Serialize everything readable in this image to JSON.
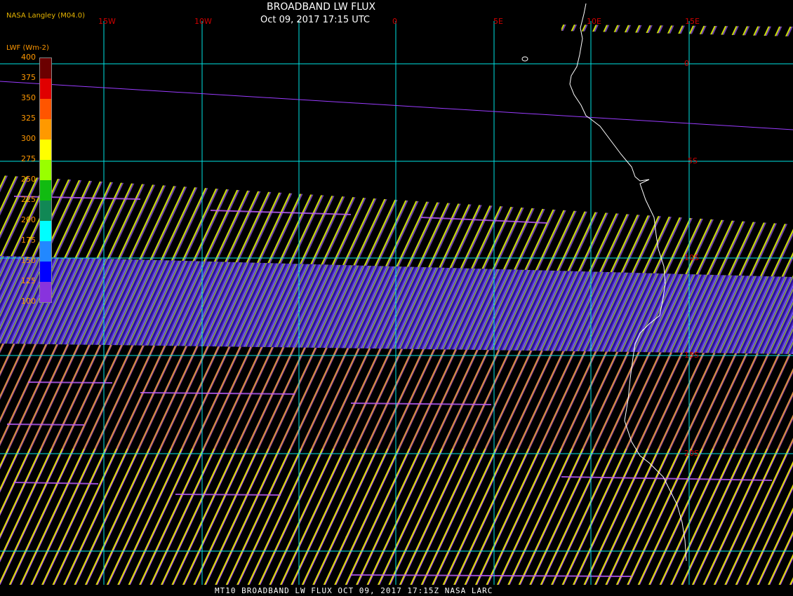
{
  "header": {
    "title": "BROADBAND LW FLUX",
    "subtitle": "Oct 09, 2017 17:15 UTC",
    "credit": "NASA Langley (M04.0)"
  },
  "colorbar": {
    "label": "LWF (Wm-2)",
    "ticks": [
      "400",
      "375",
      "350",
      "325",
      "300",
      "275",
      "250",
      "225",
      "200",
      "175",
      "150",
      "125",
      "100"
    ],
    "colors": [
      "#6b0000",
      "#e00000",
      "#ff5500",
      "#ff9900",
      "#ffff00",
      "#99ff00",
      "#11bb11",
      "#118855",
      "#00ffff",
      "#2288ff",
      "#0000ff",
      "#8833dd"
    ]
  },
  "grid": {
    "lon_labels": [
      "15W",
      "10W",
      "0",
      "5E",
      "10E",
      "15E"
    ],
    "lat_labels": [
      "0",
      "5S",
      "10S",
      "15S",
      "20S"
    ]
  },
  "footer": "MT10  BROADBAND LW FLUX  OCT 09, 2017 17:15Z  NASA LARC",
  "palette": {
    "background": "#000000",
    "grid": "#00e5e5",
    "coast": "#ffffff",
    "orbit": "#9a3cff",
    "label_red": "#d00000",
    "label_orange": "#ff9800"
  }
}
